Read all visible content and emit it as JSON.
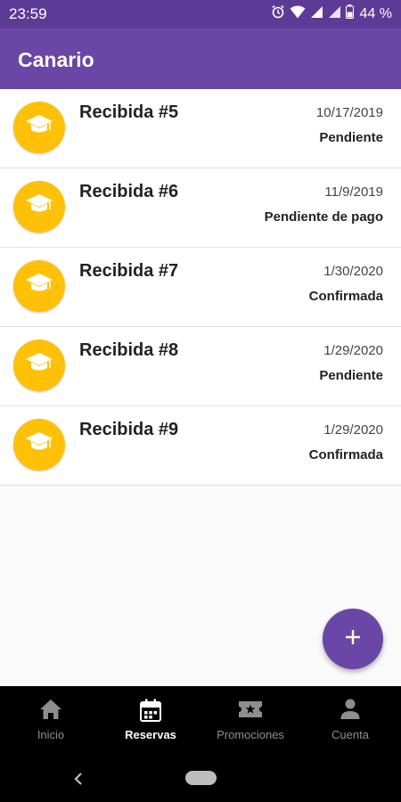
{
  "status_bar": {
    "time": "23:59",
    "battery": "44 %"
  },
  "app_bar": {
    "title": "Canario"
  },
  "reservations": [
    {
      "title": "Recibida #5",
      "date": "10/17/2019",
      "status": "Pendiente"
    },
    {
      "title": "Recibida #6",
      "date": "11/9/2019",
      "status": "Pendiente de pago"
    },
    {
      "title": "Recibida #7",
      "date": "1/30/2020",
      "status": "Confirmada"
    },
    {
      "title": "Recibida #8",
      "date": "1/29/2020",
      "status": "Pendiente"
    },
    {
      "title": "Recibida #9",
      "date": "1/29/2020",
      "status": "Confirmada"
    }
  ],
  "fab": {
    "icon": "plus-icon"
  },
  "bottom_nav": {
    "active": "Reservas",
    "items": [
      {
        "label": "Inicio",
        "icon": "home-icon"
      },
      {
        "label": "Reservas",
        "icon": "calendar-icon"
      },
      {
        "label": "Promociones",
        "icon": "ticket-icon"
      },
      {
        "label": "Cuenta",
        "icon": "person-icon"
      }
    ]
  },
  "colors": {
    "primary": "#6a46a6",
    "primary_dark": "#5d3a96",
    "avatar": "#ffc107"
  }
}
